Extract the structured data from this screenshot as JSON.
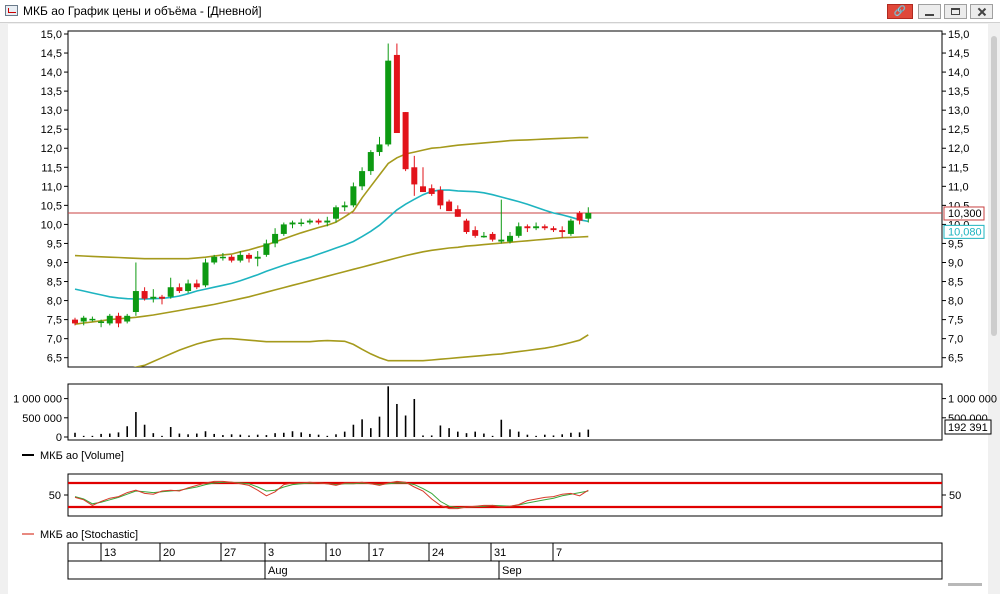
{
  "window": {
    "title": "МКБ ао График цены и объёма - [Дневной]",
    "link_glyph": "🔗"
  },
  "colors": {
    "bull": "#0d9a12",
    "bear": "#e2131a",
    "bollinger": "#a59a1c",
    "ma": "#1eb4c0",
    "ref_line": "#c84040",
    "stoch_k": "#3aa83a",
    "stoch_d": "#d83a2a",
    "stoch_bands": "#e00000"
  },
  "price_axis": {
    "ticks": [
      "15,0",
      "14,5",
      "14,0",
      "13,5",
      "13,0",
      "12,5",
      "12,0",
      "11,5",
      "11,0",
      "10,5",
      "10,0",
      "9,5",
      "9,0",
      "8,5",
      "8,0",
      "7,5",
      "7,0",
      "6,5"
    ],
    "label_last": "10,300",
    "label_ma": "10,080"
  },
  "volume_axis": {
    "ticks": [
      "1 000 000",
      "500 000",
      "0"
    ],
    "label_last": "192 391"
  },
  "legends": {
    "volume": "МКБ ао [Volume]",
    "stochastic": "МКБ ао [Stochastic]"
  },
  "stoch_axis": {
    "tick": "50"
  },
  "date_axis": {
    "days": [
      "13",
      "20",
      "27",
      "3",
      "10",
      "17",
      "24",
      "31",
      "7"
    ],
    "months": [
      "Aug",
      "Sep"
    ]
  },
  "chart_data": [
    {
      "type": "candlestick",
      "title": "",
      "ylim": [
        6.35,
        15.0
      ],
      "ohlc": [
        [
          7.5,
          7.55,
          7.35,
          7.4
        ],
        [
          7.45,
          7.6,
          7.35,
          7.55
        ],
        [
          7.5,
          7.58,
          7.45,
          7.52
        ],
        [
          7.45,
          7.5,
          7.3,
          7.45
        ],
        [
          7.4,
          7.65,
          7.35,
          7.6
        ],
        [
          7.6,
          7.68,
          7.3,
          7.4
        ],
        [
          7.45,
          7.65,
          7.4,
          7.6
        ],
        [
          7.7,
          9.0,
          7.6,
          8.25
        ],
        [
          8.25,
          8.35,
          8.0,
          8.05
        ],
        [
          8.05,
          8.3,
          7.95,
          8.1
        ],
        [
          8.1,
          8.15,
          7.9,
          8.05
        ],
        [
          8.1,
          8.6,
          8.05,
          8.35
        ],
        [
          8.35,
          8.45,
          8.2,
          8.25
        ],
        [
          8.25,
          8.55,
          8.2,
          8.45
        ],
        [
          8.45,
          8.55,
          8.3,
          8.35
        ],
        [
          8.4,
          9.1,
          8.35,
          9.0
        ],
        [
          9.0,
          9.2,
          8.95,
          9.15
        ],
        [
          9.15,
          9.25,
          9.05,
          9.15
        ],
        [
          9.15,
          9.2,
          9.0,
          9.05
        ],
        [
          9.05,
          9.3,
          9.0,
          9.2
        ],
        [
          9.2,
          9.25,
          9.0,
          9.1
        ],
        [
          9.1,
          9.3,
          8.9,
          9.15
        ],
        [
          9.2,
          9.6,
          9.15,
          9.5
        ],
        [
          9.5,
          9.9,
          9.4,
          9.75
        ],
        [
          9.75,
          10.05,
          9.7,
          10.0
        ],
        [
          10.0,
          10.1,
          9.9,
          10.05
        ],
        [
          10.05,
          10.15,
          9.95,
          10.05
        ],
        [
          10.05,
          10.15,
          10.0,
          10.1
        ],
        [
          10.1,
          10.15,
          10.0,
          10.05
        ],
        [
          10.05,
          10.2,
          9.95,
          10.1
        ],
        [
          10.15,
          10.5,
          10.05,
          10.45
        ],
        [
          10.45,
          10.6,
          10.35,
          10.5
        ],
        [
          10.5,
          11.1,
          10.45,
          11.0
        ],
        [
          11.0,
          11.5,
          10.9,
          11.4
        ],
        [
          11.4,
          11.95,
          11.3,
          11.9
        ],
        [
          11.9,
          12.3,
          11.8,
          12.1
        ],
        [
          12.1,
          14.75,
          12.05,
          14.3
        ],
        [
          14.45,
          14.75,
          12.6,
          12.4
        ],
        [
          12.95,
          12.95,
          11.4,
          11.45
        ],
        [
          11.5,
          11.8,
          10.75,
          11.05
        ],
        [
          11.0,
          11.5,
          10.85,
          10.85
        ],
        [
          10.95,
          11.05,
          10.75,
          10.8
        ],
        [
          10.9,
          11.0,
          10.4,
          10.5
        ],
        [
          10.6,
          10.65,
          10.35,
          10.35
        ],
        [
          10.4,
          10.5,
          10.2,
          10.2
        ],
        [
          10.1,
          10.15,
          9.75,
          9.8
        ],
        [
          9.85,
          9.95,
          9.65,
          9.7
        ],
        [
          9.7,
          9.8,
          9.65,
          9.7
        ],
        [
          9.75,
          9.8,
          9.55,
          9.6
        ],
        [
          9.55,
          10.65,
          9.5,
          9.6
        ],
        [
          9.55,
          9.8,
          9.5,
          9.7
        ],
        [
          9.7,
          10.05,
          9.65,
          9.95
        ],
        [
          9.95,
          10.0,
          9.8,
          9.9
        ],
        [
          9.9,
          10.05,
          9.85,
          9.95
        ],
        [
          9.95,
          10.0,
          9.85,
          9.9
        ],
        [
          9.9,
          9.95,
          9.8,
          9.85
        ],
        [
          9.85,
          9.95,
          9.65,
          9.8
        ],
        [
          9.75,
          10.15,
          9.7,
          10.1
        ],
        [
          10.3,
          10.35,
          10.0,
          10.1
        ],
        [
          10.15,
          10.45,
          10.05,
          10.3
        ]
      ],
      "reference_line": 10.3,
      "ma": [
        8.3,
        8.25,
        8.2,
        8.15,
        8.1,
        8.07,
        8.05,
        8.04,
        8.04,
        8.05,
        8.06,
        8.08,
        8.12,
        8.18,
        8.25,
        8.3,
        8.35,
        8.4,
        8.45,
        8.52,
        8.6,
        8.68,
        8.77,
        8.85,
        8.93,
        9.0,
        9.07,
        9.14,
        9.22,
        9.3,
        9.38,
        9.46,
        9.55,
        9.68,
        9.82,
        9.98,
        10.18,
        10.38,
        10.53,
        10.66,
        10.78,
        10.87,
        10.9,
        10.9,
        10.88,
        10.87,
        10.86,
        10.83,
        10.78,
        10.72,
        10.66,
        10.6,
        10.53,
        10.45,
        10.37,
        10.3,
        10.25,
        10.19,
        10.12,
        10.08
      ],
      "bollinger_upper": [
        9.18,
        9.17,
        9.16,
        9.15,
        9.14,
        9.13,
        9.12,
        9.11,
        9.1,
        9.1,
        9.1,
        9.1,
        9.1,
        9.1,
        9.12,
        9.14,
        9.17,
        9.2,
        9.22,
        9.28,
        9.33,
        9.4,
        9.46,
        9.54,
        9.62,
        9.7,
        9.78,
        9.85,
        9.92,
        9.98,
        10.06,
        10.2,
        10.35,
        10.7,
        11.0,
        11.3,
        11.6,
        11.75,
        11.85,
        11.9,
        11.95,
        12.0,
        12.02,
        12.05,
        12.08,
        12.1,
        12.12,
        12.14,
        12.16,
        12.18,
        12.2,
        12.21,
        12.22,
        12.23,
        12.24,
        12.25,
        12.26,
        12.27,
        12.28,
        12.28
      ],
      "bollinger_lower": [
        7.38,
        7.41,
        7.44,
        7.47,
        7.5,
        7.52,
        7.54,
        7.56,
        7.59,
        7.62,
        7.66,
        7.7,
        7.74,
        7.78,
        7.82,
        7.86,
        7.9,
        7.95,
        8.0,
        8.05,
        8.1,
        8.16,
        8.22,
        8.28,
        8.34,
        8.4,
        8.46,
        8.52,
        8.58,
        8.64,
        8.7,
        8.76,
        8.82,
        8.88,
        8.94,
        9.0,
        9.06,
        9.12,
        9.18,
        9.23,
        9.28,
        9.32,
        9.35,
        9.38,
        9.4,
        9.43,
        9.45,
        9.47,
        9.49,
        9.51,
        9.53,
        9.55,
        9.57,
        9.59,
        9.61,
        9.63,
        9.65,
        9.66,
        9.67,
        9.68
      ],
      "envelope_lower": [
        5.8,
        5.9,
        6.0,
        6.05,
        6.1,
        6.15,
        6.2,
        6.25,
        6.3,
        6.4,
        6.5,
        6.6,
        6.7,
        6.78,
        6.86,
        6.92,
        6.97,
        7.0,
        7.0,
        6.98,
        6.96,
        6.94,
        6.92,
        6.92,
        6.92,
        6.92,
        6.92,
        6.92,
        6.94,
        6.95,
        6.94,
        6.93,
        6.85,
        6.72,
        6.6,
        6.5,
        6.42,
        6.42,
        6.42,
        6.42,
        6.42,
        6.44,
        6.46,
        6.48,
        6.5,
        6.52,
        6.54,
        6.56,
        6.58,
        6.6,
        6.63,
        6.66,
        6.69,
        6.72,
        6.75,
        6.79,
        6.84,
        6.9,
        6.96,
        7.1
      ]
    },
    {
      "type": "bar",
      "title": "",
      "ylabel": "",
      "ylim": [
        0,
        1250000
      ],
      "values": [
        110000,
        30000,
        30000,
        80000,
        90000,
        120000,
        280000,
        650000,
        320000,
        100000,
        30000,
        260000,
        90000,
        70000,
        90000,
        150000,
        80000,
        50000,
        70000,
        60000,
        40000,
        60000,
        50000,
        100000,
        110000,
        150000,
        120000,
        80000,
        60000,
        30000,
        70000,
        140000,
        320000,
        460000,
        230000,
        530000,
        1320000,
        860000,
        560000,
        990000,
        40000,
        40000,
        300000,
        230000,
        140000,
        100000,
        140000,
        90000,
        30000,
        450000,
        200000,
        140000,
        60000,
        30000,
        60000,
        40000,
        70000,
        110000,
        120000,
        192391
      ]
    },
    {
      "type": "line",
      "title": "",
      "ylim": [
        0,
        100
      ],
      "bands": [
        20,
        80
      ],
      "series": [
        {
          "values": [
            46,
            40,
            28,
            32,
            38,
            44,
            52,
            60,
            58,
            56,
            58,
            60,
            62,
            66,
            70,
            76,
            80,
            82,
            82,
            80,
            78,
            70,
            60,
            62,
            70,
            76,
            78,
            80,
            80,
            78,
            76,
            78,
            78,
            80,
            78,
            76,
            78,
            80,
            80,
            76,
            66,
            54,
            34,
            22,
            18,
            20,
            21,
            22,
            24,
            23,
            22,
            25,
            30,
            34,
            38,
            42,
            48,
            52,
            56,
            60
          ]
        },
        {
          "values": [
            44,
            38,
            24,
            34,
            42,
            46,
            56,
            62,
            54,
            52,
            60,
            62,
            60,
            68,
            74,
            80,
            84,
            84,
            82,
            78,
            74,
            62,
            48,
            58,
            76,
            80,
            80,
            82,
            80,
            78,
            74,
            80,
            80,
            82,
            78,
            74,
            80,
            84,
            82,
            70,
            60,
            40,
            24,
            16,
            16,
            20,
            22,
            24,
            24,
            20,
            22,
            26,
            36,
            40,
            44,
            46,
            52,
            54,
            48,
            62
          ]
        }
      ]
    }
  ]
}
